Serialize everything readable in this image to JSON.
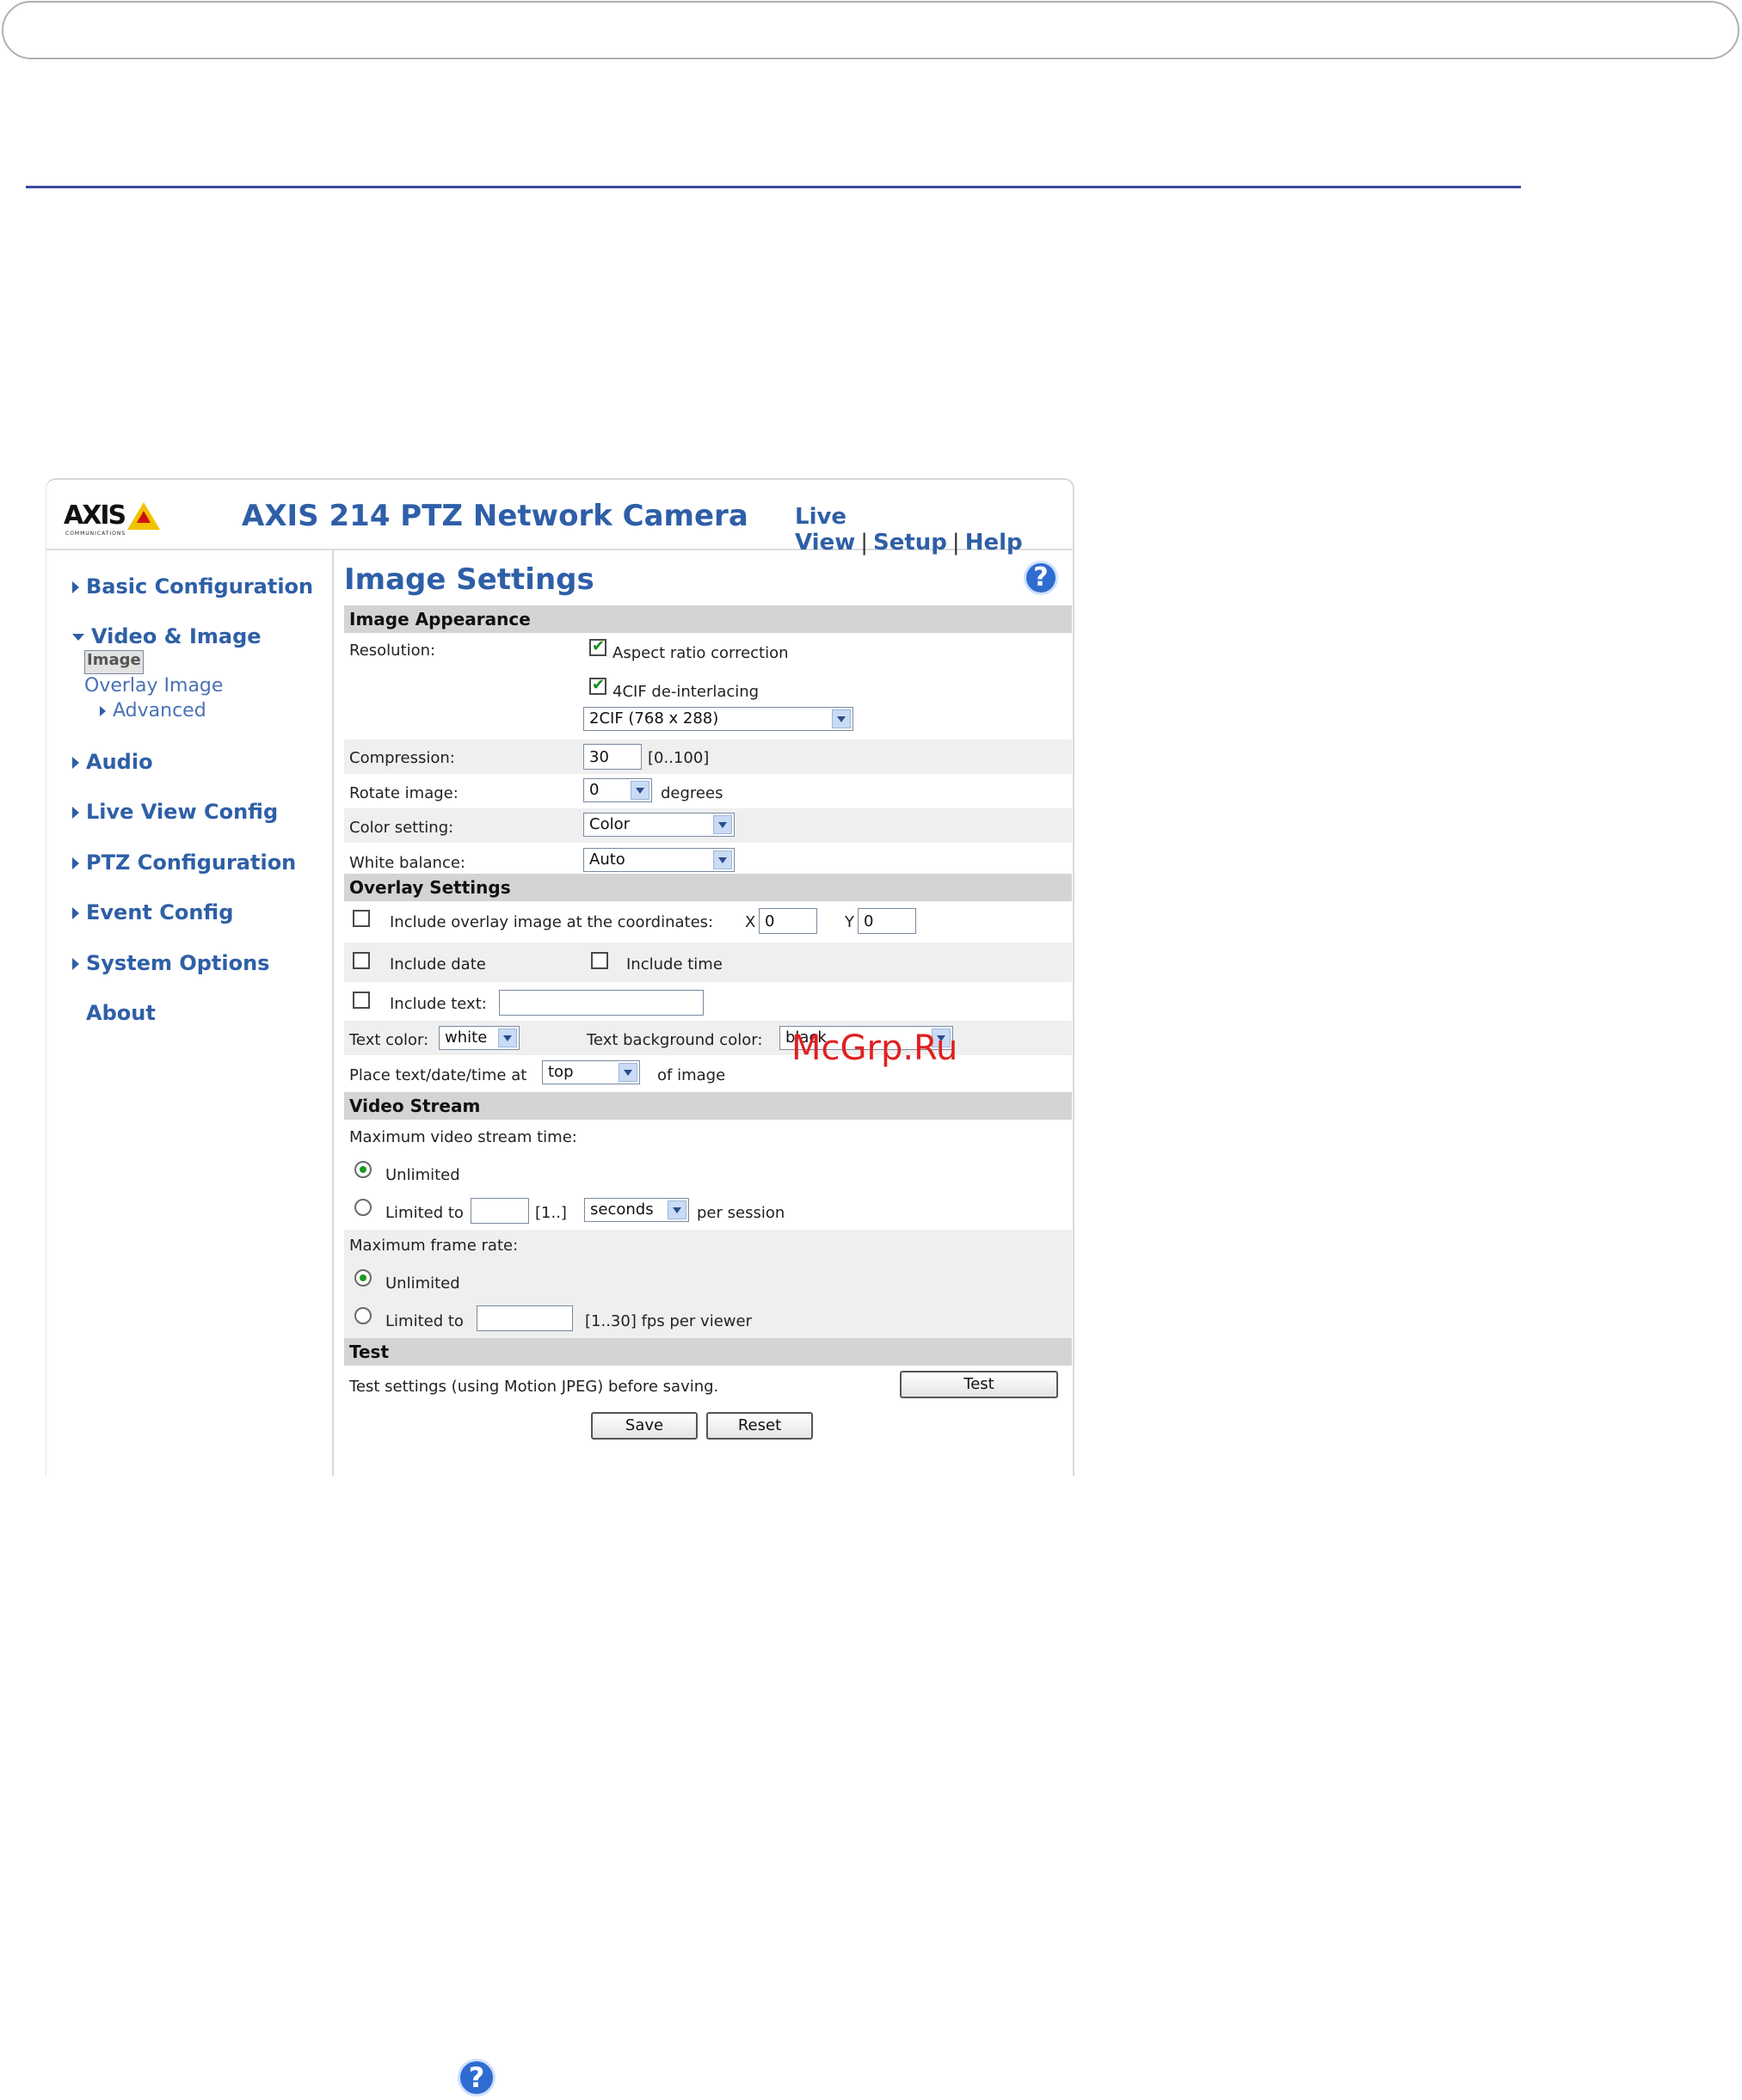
{
  "header": {
    "logo_text": "AXIS",
    "logo_sub": "COMMUNICATIONS",
    "camera_title": "AXIS 214 PTZ Network Camera",
    "links": [
      "Live View",
      "Setup",
      "Help"
    ],
    "link_separator": "|"
  },
  "sidebar": {
    "items": [
      {
        "label": "Basic Configuration"
      },
      {
        "label": "Video & Image"
      },
      {
        "label": "Audio"
      },
      {
        "label": "Live View Config"
      },
      {
        "label": "PTZ Configuration"
      },
      {
        "label": "Event Config"
      },
      {
        "label": "System Options"
      },
      {
        "label": "About"
      }
    ],
    "subitems": [
      "Image",
      "Overlay Image",
      "Advanced"
    ],
    "selected_subitem": "Image"
  },
  "main": {
    "title": "Image Settings",
    "help_glyph": "?",
    "image_appearance": {
      "heading": "Image Appearance",
      "resolution_label": "Resolution:",
      "aspect_ratio_label": "Aspect ratio correction",
      "aspect_ratio_checked": true,
      "deinterlace_label": "4CIF de-interlacing",
      "deinterlace_checked": true,
      "resolution_value": "2CIF (768 x 288)",
      "compression_label": "Compression:",
      "compression_value": "30",
      "compression_range": "[0..100]",
      "rotate_label": "Rotate image:",
      "rotate_value": "0",
      "rotate_unit": "degrees",
      "color_label": "Color setting:",
      "color_value": "Color",
      "wb_label": "White balance:",
      "wb_value": "Auto"
    },
    "overlay": {
      "heading": "Overlay Settings",
      "overlay_image_label": "Include overlay image at the coordinates:",
      "x_label": "X",
      "x_value": "0",
      "y_label": "Y",
      "y_value": "0",
      "include_date_label": "Include date",
      "include_time_label": "Include time",
      "include_text_label": "Include text:",
      "include_text_value": "",
      "text_color_label": "Text color:",
      "text_color_value": "white",
      "text_bg_label": "Text background color:",
      "text_bg_value": "black",
      "place_label": "Place text/date/time at",
      "place_value": "top",
      "place_suffix": "of image"
    },
    "video_stream": {
      "heading": "Video Stream",
      "max_time_label": "Maximum video stream time:",
      "unlimited_label": "Unlimited",
      "limited_label": "Limited to",
      "limited_value": "",
      "limited_range": "[1..]",
      "limited_unit": "seconds",
      "limited_suffix": "per session",
      "max_fps_label": "Maximum frame rate:",
      "fps_unlimited_label": "Unlimited",
      "fps_limited_label": "Limited to",
      "fps_limited_value": "",
      "fps_suffix": "[1..30] fps per viewer"
    },
    "test": {
      "heading": "Test",
      "description": "Test settings (using Motion JPEG) before saving.",
      "test_button": "Test"
    },
    "save_button": "Save",
    "reset_button": "Reset"
  },
  "watermark": "McGrp.Ru",
  "bottom_help_glyph": "?",
  "colors": {
    "accent": "#2e5fa7",
    "section_bg": "#d4d4d4",
    "band_bg": "#efefef",
    "rule": "#3b4a9a"
  }
}
